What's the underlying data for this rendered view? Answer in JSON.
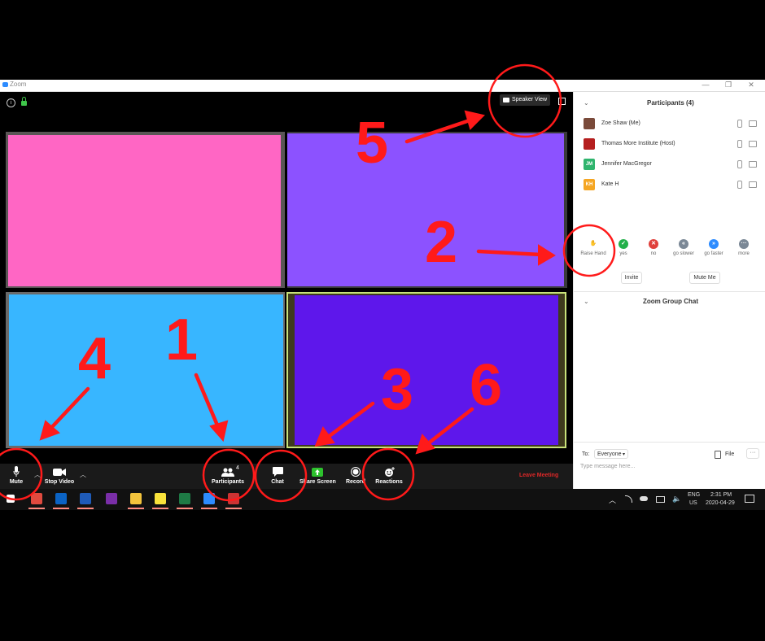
{
  "window": {
    "title": "Zoom",
    "controls": [
      "—",
      "❐",
      "✕"
    ]
  },
  "meeting": {
    "speaker_view_label": "Speaker View",
    "tiles": [
      {
        "color": "#ff66c4",
        "frame": "#5b5656"
      },
      {
        "color": "#8c52ff",
        "frame": "#3a3a3a"
      },
      {
        "color": "#38b6ff",
        "frame": "#6a6a6a"
      },
      {
        "color": "#5e17eb",
        "frame": "#3e3a1d",
        "active_border": "#c8e27a"
      }
    ]
  },
  "toolbar": {
    "mute": "Mute",
    "stop_video": "Stop Video",
    "participants": "Participants",
    "participants_count": "4",
    "chat": "Chat",
    "share_screen": "Share Screen",
    "record": "Record",
    "reactions": "Reactions",
    "leave": "Leave Meeting",
    "leave_color": "#e02828",
    "share_color": "#2dc22d"
  },
  "panel": {
    "participants_title": "Participants (4)",
    "participants": [
      {
        "name": "Zoe Shaw (Me)",
        "initials": "",
        "color": "#7a4a3a"
      },
      {
        "name": "Thomas More Institute (Host)",
        "initials": "",
        "color": "#b51f1f"
      },
      {
        "name": "Jennifer MacGregor",
        "initials": "JM",
        "color": "#2fb46d"
      },
      {
        "name": "Kate H",
        "initials": "KH",
        "color": "#f5a623"
      }
    ],
    "feedback": [
      {
        "label": "Raise Hand",
        "icon": "raise-hand-icon",
        "color": "#2d8cff"
      },
      {
        "label": "yes",
        "icon": "check-icon",
        "color": "#23b04a"
      },
      {
        "label": "no",
        "icon": "x-icon",
        "color": "#e0403c"
      },
      {
        "label": "go slower",
        "icon": "rewind-icon",
        "color": "#7b8896"
      },
      {
        "label": "go faster",
        "icon": "fast-forward-icon",
        "color": "#2d8cff"
      },
      {
        "label": "more",
        "icon": "more-icon",
        "color": "#7b8896"
      }
    ],
    "invite": "Invite",
    "mute_me": "Mute Me",
    "chat_title": "Zoom Group Chat",
    "to_label": "To:",
    "to_value": "Everyone",
    "file_label": "File",
    "more_label": "···",
    "message_placeholder": "Type message here..."
  },
  "taskbar": {
    "lang_top": "ENG",
    "lang_bottom": "US",
    "time": "2:31 PM",
    "date": "2020-04-29",
    "apps": [
      {
        "icon": "windows-icon",
        "color": "#ffffff"
      },
      {
        "icon": "chrome-icon",
        "color": "#e04a3f"
      },
      {
        "icon": "outlook-icon",
        "color": "#0b63c4"
      },
      {
        "icon": "word-icon",
        "color": "#1f5bb8"
      },
      {
        "icon": "onenote-icon",
        "color": "#7a2ea8"
      },
      {
        "icon": "file-explorer-icon",
        "color": "#f3c33c"
      },
      {
        "icon": "sticky-notes-icon",
        "color": "#f9e23b"
      },
      {
        "icon": "excel-icon",
        "color": "#1e7a45"
      },
      {
        "icon": "zoom-icon",
        "color": "#2d8cff"
      },
      {
        "icon": "app-icon",
        "color": "#cc3333"
      }
    ]
  },
  "annotations": {
    "labels": [
      "1",
      "2",
      "3",
      "4",
      "5",
      "6"
    ],
    "color": "#ff1a1a"
  }
}
